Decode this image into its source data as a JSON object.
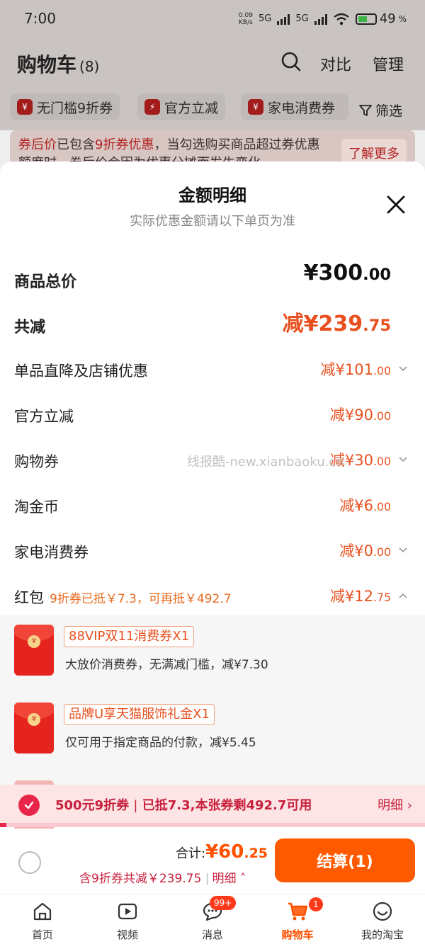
{
  "status": {
    "time": "7:00",
    "netspeed_value": "0.09",
    "netspeed_unit": "KB/s",
    "net1": "5G",
    "net2": "5G",
    "battery": "49",
    "battery_unit": "%"
  },
  "header": {
    "title": "购物车",
    "count": "(8)",
    "compare": "对比",
    "manage": "管理"
  },
  "chips": [
    {
      "icon": "¥",
      "label": "无门槛9折券"
    },
    {
      "icon": "⚡",
      "label": "官方立减"
    },
    {
      "icon": "¥",
      "label": "家电消费券"
    }
  ],
  "filter_label": "筛选",
  "notice": {
    "red1": "券后价",
    "text1": "已包含",
    "red2": "9折券优惠",
    "text2": "，当勾选购买商品超过券优惠额度时，券后价会因为优惠分摊而发生变化",
    "more": "了解更多"
  },
  "sheet": {
    "title": "金额明细",
    "subtitle": "实际优惠金额请以下单页为准",
    "rows": [
      {
        "label": "商品总价",
        "prefix": "¥",
        "int": "300",
        "dec": ".00"
      },
      {
        "label": "共减",
        "prefix": "减¥",
        "int": "239",
        "dec": ".75"
      },
      {
        "label": "单品直降及店铺优惠",
        "prefix": "减¥",
        "int": "101",
        "dec": ".00"
      },
      {
        "label": "官方立减",
        "prefix": "减¥",
        "int": "90",
        "dec": ".00"
      },
      {
        "label": "购物券",
        "prefix": "减¥",
        "int": "30",
        "dec": ".00"
      },
      {
        "label": "淘金币",
        "prefix": "减¥",
        "int": "6",
        "dec": ".00"
      },
      {
        "label": "家电消费券",
        "prefix": "减¥",
        "int": "0",
        "dec": ".00"
      },
      {
        "label": "红包",
        "hint": "9折券已抵￥7.3，可再抵￥492.7",
        "prefix": "减¥",
        "int": "12",
        "dec": ".75"
      }
    ],
    "coupons": [
      {
        "tag": "88VIP双11消费券X1",
        "desc": "大放价消费券，无满减门槛，减¥7.30"
      },
      {
        "tag": "品牌U享天猫服饰礼金X1",
        "desc": "仅可用于指定商品的付款，减¥5.45"
      }
    ],
    "watermark": "线报酷-new.xianbaoku.cn"
  },
  "promo": {
    "coupon": "500元9折券",
    "sep": "|",
    "used": "已抵7.3,本张券剩492.7可用",
    "detail": "明细",
    "progress": 0.015
  },
  "checkout": {
    "total_label": "合计:",
    "total_int": "¥60",
    "total_dec": ".25",
    "saved": "含9折券共减￥239.75",
    "sep": "|",
    "detail": "明细",
    "pay": "结算(1)"
  },
  "tabs": [
    {
      "label": "首页"
    },
    {
      "label": "视频"
    },
    {
      "label": "消息",
      "badge": "99+"
    },
    {
      "label": "购物车",
      "badge": "1"
    },
    {
      "label": "我的淘宝"
    }
  ],
  "colors": {
    "accent": "#ff5000",
    "discount": "#e8501f",
    "promo_red": "#c81f3c"
  }
}
